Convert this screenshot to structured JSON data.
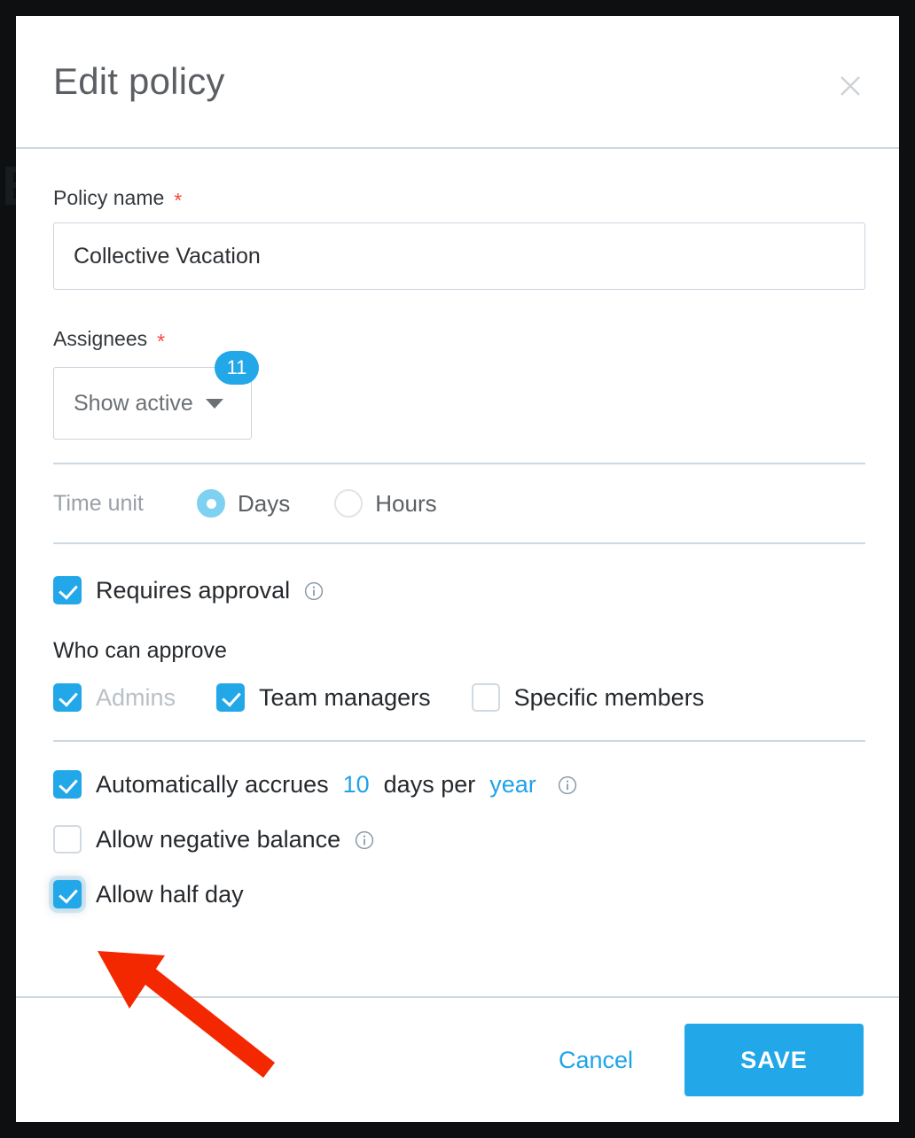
{
  "background": {
    "behind_text": "B",
    "overlay_color": "#0d0f11"
  },
  "colors": {
    "accent": "#22a7e8",
    "link": "#1fa3e8",
    "required": "#f4493c",
    "divider": "#ccd8e2",
    "annotation_arrow": "#f42800"
  },
  "header": {
    "title": "Edit policy",
    "close_icon": "close-icon"
  },
  "form": {
    "policy_name": {
      "label": "Policy name",
      "required_marker": "*",
      "value": "Collective Vacation",
      "placeholder": "Policy name"
    },
    "assignees": {
      "label": "Assignees",
      "required_marker": "*",
      "dropdown_label": "Show active",
      "count_badge": "11",
      "caret_icon": "chevron-down-icon"
    },
    "time_unit": {
      "label": "Time unit",
      "options": [
        {
          "label": "Days",
          "selected": true
        },
        {
          "label": "Hours",
          "selected": false
        }
      ]
    },
    "requires_approval": {
      "label": "Requires approval",
      "checked": true,
      "info_icon": "info-icon"
    },
    "who_can_approve": {
      "title": "Who can approve",
      "options": [
        {
          "label": "Admins",
          "checked": true,
          "disabled": true
        },
        {
          "label": "Team managers",
          "checked": true,
          "disabled": false
        },
        {
          "label": "Specific members",
          "checked": false,
          "disabled": false
        }
      ]
    },
    "auto_accrue": {
      "checked": true,
      "text_before": "Automatically accrues",
      "amount": "10",
      "text_middle": "days per",
      "period": "year",
      "info_icon": "info-icon"
    },
    "allow_negative_balance": {
      "label": "Allow negative balance",
      "checked": false,
      "info_icon": "info-icon"
    },
    "allow_half_day": {
      "label": "Allow half day",
      "checked": true,
      "focused": true
    }
  },
  "footer": {
    "cancel_label": "Cancel",
    "save_label": "SAVE"
  }
}
